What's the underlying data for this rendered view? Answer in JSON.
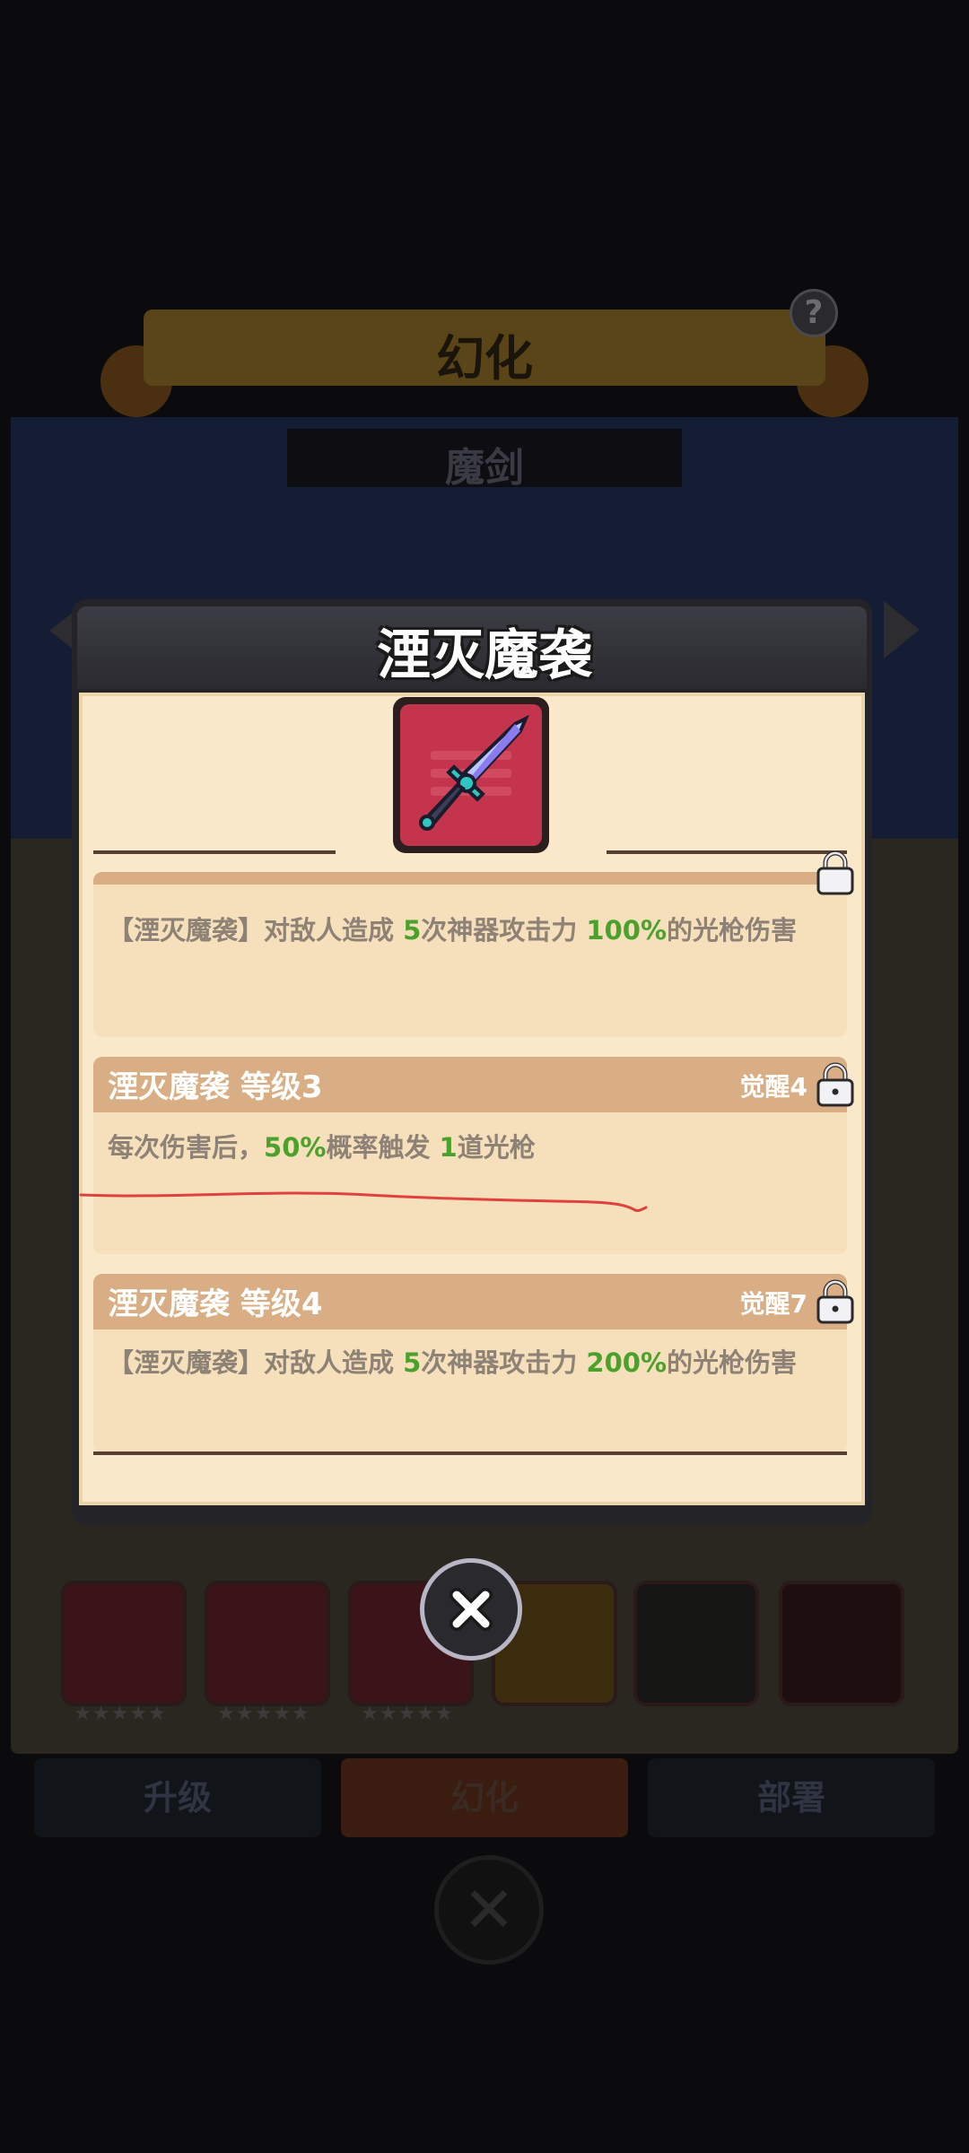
{
  "background": {
    "screen_title": "幻化",
    "weapon_name": "魔剑",
    "help_symbol": "?",
    "item_stars": [
      "★★★★★",
      "★★★★★",
      "★★★★★"
    ],
    "bottom_tabs": [
      {
        "label": "升级"
      },
      {
        "label": "幻化"
      },
      {
        "label": "部署"
      }
    ],
    "close_symbol": "✕"
  },
  "modal": {
    "title": "湮灭魔袭",
    "skill_icon": "sword-icon",
    "cards": [
      {
        "title": "",
        "condition": "",
        "desc_parts": [
          "【湮灭魔袭】对敌人造成 ",
          "5",
          "次神器攻击力 ",
          "100%",
          "的光枪伤害"
        ]
      },
      {
        "title": "湮灭魔袭 等级3",
        "condition": "觉醒4",
        "desc_parts": [
          "每次伤害后，",
          "50%",
          "概率触发 ",
          "1",
          "道光枪"
        ]
      },
      {
        "title": "湮灭魔袭 等级4",
        "condition": "觉醒7",
        "desc_parts": [
          "【湮灭魔袭】对敌人造成 ",
          "5",
          "次神器攻击力 ",
          "200%",
          "的光枪伤害"
        ]
      }
    ],
    "close_symbol": "✕"
  },
  "colors": {
    "highlight_green": "#4aa12b",
    "card_header": "#d9ae84",
    "annotation_red": "#e0413c"
  }
}
